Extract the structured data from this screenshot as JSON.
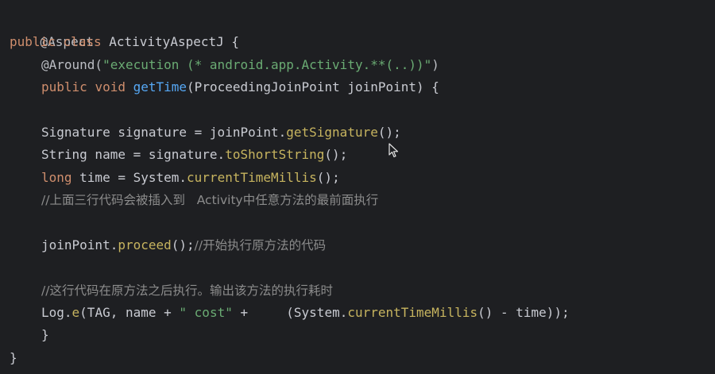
{
  "code": {
    "l1": {
      "annotation": "@Aspect"
    },
    "l2": {
      "kw1": "public",
      "kw2": "class",
      "name": "ActivityAspectJ",
      "brace": " {"
    },
    "l3": {
      "annotation": "@Around(",
      "str": "\"execution (* android.app.Activity.**(..))\"",
      "close": ")"
    },
    "l4": {
      "kw1": "public",
      "kw2": "void",
      "fn": "getTime",
      "params": "(ProceedingJoinPoint joinPoint) {"
    },
    "l6": {
      "a": "Signature signature = joinPoint.",
      "call": "getSignature",
      "end": "();"
    },
    "l7": {
      "a": "String name = signature.",
      "call": "toShortString",
      "end": "();"
    },
    "l8": {
      "kw": "long",
      "a": " time = System.",
      "call": "currentTimeMillis",
      "end": "();"
    },
    "l9": {
      "comment": "//上面三行代码会被插入到   Activity中任意方法的最前面执行"
    },
    "l11": {
      "a": "joinPoint.",
      "call": "proceed",
      "end": "();",
      "comment": "//开始执行原方法的代码"
    },
    "l13": {
      "comment": "//这行代码在原方法之后执行。输出该方法的执行耗时"
    },
    "l14": {
      "a": "Log.",
      "call1": "e",
      "b": "(TAG, name + ",
      "str": "\" cost\"",
      "c": " +     (System.",
      "call2": "currentTimeMillis",
      "end": "() - time));"
    },
    "l15": {
      "brace": "}"
    },
    "l16": {
      "brace": "}"
    }
  },
  "colors": {
    "background": "#1e1f22",
    "keyword": "#cf8e6d",
    "string": "#6aab73",
    "function_decl": "#56a8f5",
    "method_call": "#c7b45f",
    "comment": "#8c8c8c"
  }
}
